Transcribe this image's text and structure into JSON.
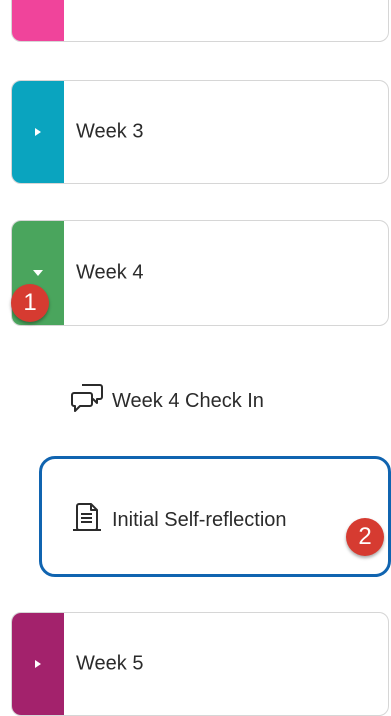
{
  "colors": {
    "pink": "#f0449b",
    "teal": "#0aa4bf",
    "green": "#4aa55d",
    "magenta": "#a3226c",
    "highlight": "#1064b0",
    "badge": "#d63b31"
  },
  "modules": [
    {
      "label": "",
      "state": "collapsed"
    },
    {
      "label": "Week 3",
      "state": "collapsed"
    },
    {
      "label": "Week 4",
      "state": "expanded"
    },
    {
      "label": "Week 5",
      "state": "collapsed"
    }
  ],
  "week4_items": [
    {
      "label": "Week 4 Check In",
      "icon": "discussion-icon"
    },
    {
      "label": "Initial Self-reflection",
      "icon": "document-icon"
    }
  ],
  "callouts": {
    "one": "1",
    "two": "2"
  }
}
